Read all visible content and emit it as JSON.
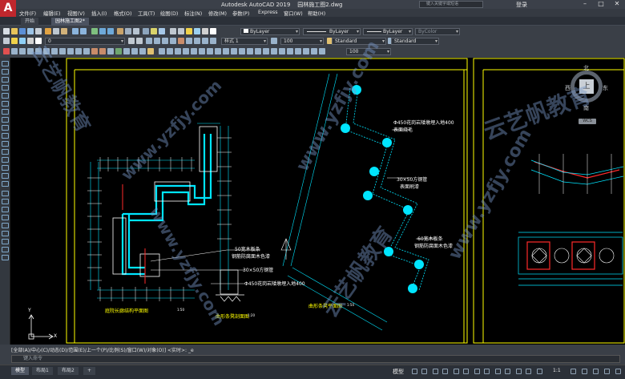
{
  "window": {
    "app_title": "Autodesk AutoCAD 2019",
    "file_name": "园林施工图2.dwg",
    "search_placeholder": "键入关键字或短语",
    "login_label": "登录",
    "app_logo_letter": "A"
  },
  "menu": [
    "文件(F)",
    "编辑(E)",
    "视图(V)",
    "插入(I)",
    "格式(O)",
    "工具(T)",
    "绘图(D)",
    "标注(N)",
    "修改(M)",
    "参数(P)",
    "Express",
    "窗口(W)",
    "帮助(H)"
  ],
  "file_tabs": [
    {
      "label": "开始",
      "active": false
    },
    {
      "label": "园林施工图2*",
      "active": true
    }
  ],
  "toolbar": {
    "layer_value": "0",
    "color_value": "ByLayer",
    "linetype_value": "ByLayer",
    "lineweight_value": "ByLayer",
    "plotstyle_value": "ByColor",
    "dimstyle_value": "样式 1",
    "scale_value_1": "100",
    "textstyle_value": "Standard",
    "tablestyle_value": "Standard",
    "scale_value_2": "100"
  },
  "drawing": {
    "label_plan_a": "庭院长廊结构平面图",
    "label_plan_a_scale": "1:50",
    "label_detail": "曲形条凳剖面图",
    "label_detail_scale": "1:20",
    "label_plan_b": "曲形条凳平面图",
    "label_plan_b_scale": "1:50",
    "note_1a": "50宽木板条",
    "note_1b": "钢筋防腐面木色漆",
    "note_2": "30×50方钢管",
    "note_3": "Φ450花岗岩矮墩埋入地400",
    "note_4a": "Φ450花岗岩矮墩埋入地400",
    "note_4b": "表面烧毛",
    "note_5a": "30×50方钢管",
    "note_5b": "表面刷漆",
    "note_6a": "60宽木板条",
    "note_6b": "钢筋防腐面木色漆"
  },
  "viewcube": {
    "north": "北",
    "south": "南",
    "east": "东",
    "west": "西",
    "top_face": "上",
    "wcs": "WCS"
  },
  "ucs": {
    "y": "Y",
    "x": "X"
  },
  "command": {
    "history": "[全部(A)/中心(C)/动态(D)/范围(E)/上一个(P)/比例(S)/窗口(W)/对象(O)] <实时>: _e",
    "input_placeholder": "键入命令"
  },
  "status": {
    "layout_tabs": [
      {
        "label": "模型",
        "active": true
      },
      {
        "label": "布局1",
        "active": false
      },
      {
        "label": "布局2",
        "active": false
      }
    ],
    "model_label": "模型",
    "scale": "1:1"
  },
  "watermark": {
    "brand_cn": "云艺帆教育",
    "brand_url": "www.yzfjy.com"
  },
  "colors": {
    "accent": "#c0272d",
    "canvas": "#000000",
    "cad_cyan": "#00e5ff",
    "cad_yellow": "#ffff00",
    "cad_red": "#ff2a2a"
  }
}
